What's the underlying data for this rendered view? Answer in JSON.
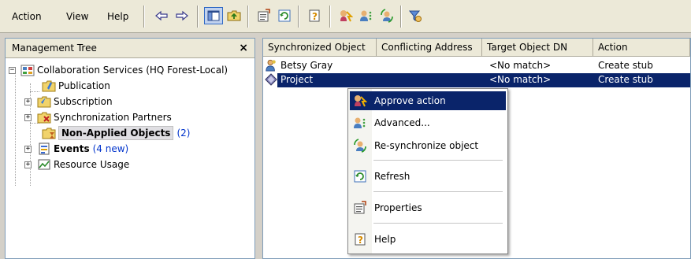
{
  "menu": {
    "action": "Action",
    "view": "View",
    "help": "Help"
  },
  "toolbar": {
    "icons": [
      "back-arrow-icon",
      "forward-arrow-icon",
      "show-hide-console-tree-icon",
      "up-one-level-icon",
      "properties-icon",
      "refresh-icon",
      "help-icon",
      "approve-action-icon",
      "advanced-icon",
      "resynchronize-icon",
      "filter-icon"
    ]
  },
  "tree": {
    "header": "Management Tree",
    "close_glyph": "×",
    "root": {
      "label": "Collaboration Services (HQ Forest-Local)",
      "expander": "−"
    },
    "items": [
      {
        "label": "Publication",
        "expander": ""
      },
      {
        "label": "Subscription",
        "expander": "+"
      },
      {
        "label": "Synchronization Partners",
        "expander": "+"
      },
      {
        "label": "Non-Applied Objects",
        "count": "(2)",
        "expander": ""
      },
      {
        "label": "Events",
        "count": "(4 new)",
        "expander": "+"
      },
      {
        "label": "Resource Usage",
        "expander": "+"
      }
    ]
  },
  "list": {
    "columns": [
      "Synchronized Object",
      "Conflicting Address",
      "Target Object DN",
      "Action"
    ],
    "rows": [
      {
        "object": "Betsy Gray",
        "conflicting": "",
        "target": "<No match>",
        "action": "Create stub",
        "icon": "user-icon"
      },
      {
        "object": "Project",
        "conflicting": "",
        "target": "<No match>",
        "action": "Create stub",
        "icon": "public-folder-icon"
      }
    ]
  },
  "context_menu": {
    "items": [
      {
        "label": "Approve action",
        "icon": "approve-action-icon"
      },
      {
        "label": "Advanced...",
        "icon": "advanced-icon"
      },
      {
        "label": "Re-synchronize object",
        "icon": "resynchronize-icon"
      },
      {
        "label": "Refresh",
        "icon": "refresh-icon"
      },
      {
        "label": "Properties",
        "icon": "properties-icon"
      },
      {
        "label": "Help",
        "icon": "help-icon"
      }
    ]
  },
  "colors": {
    "selection": "#0a246a",
    "count_text": "#0033cc",
    "toolbar_bg": "#ece9d8"
  }
}
